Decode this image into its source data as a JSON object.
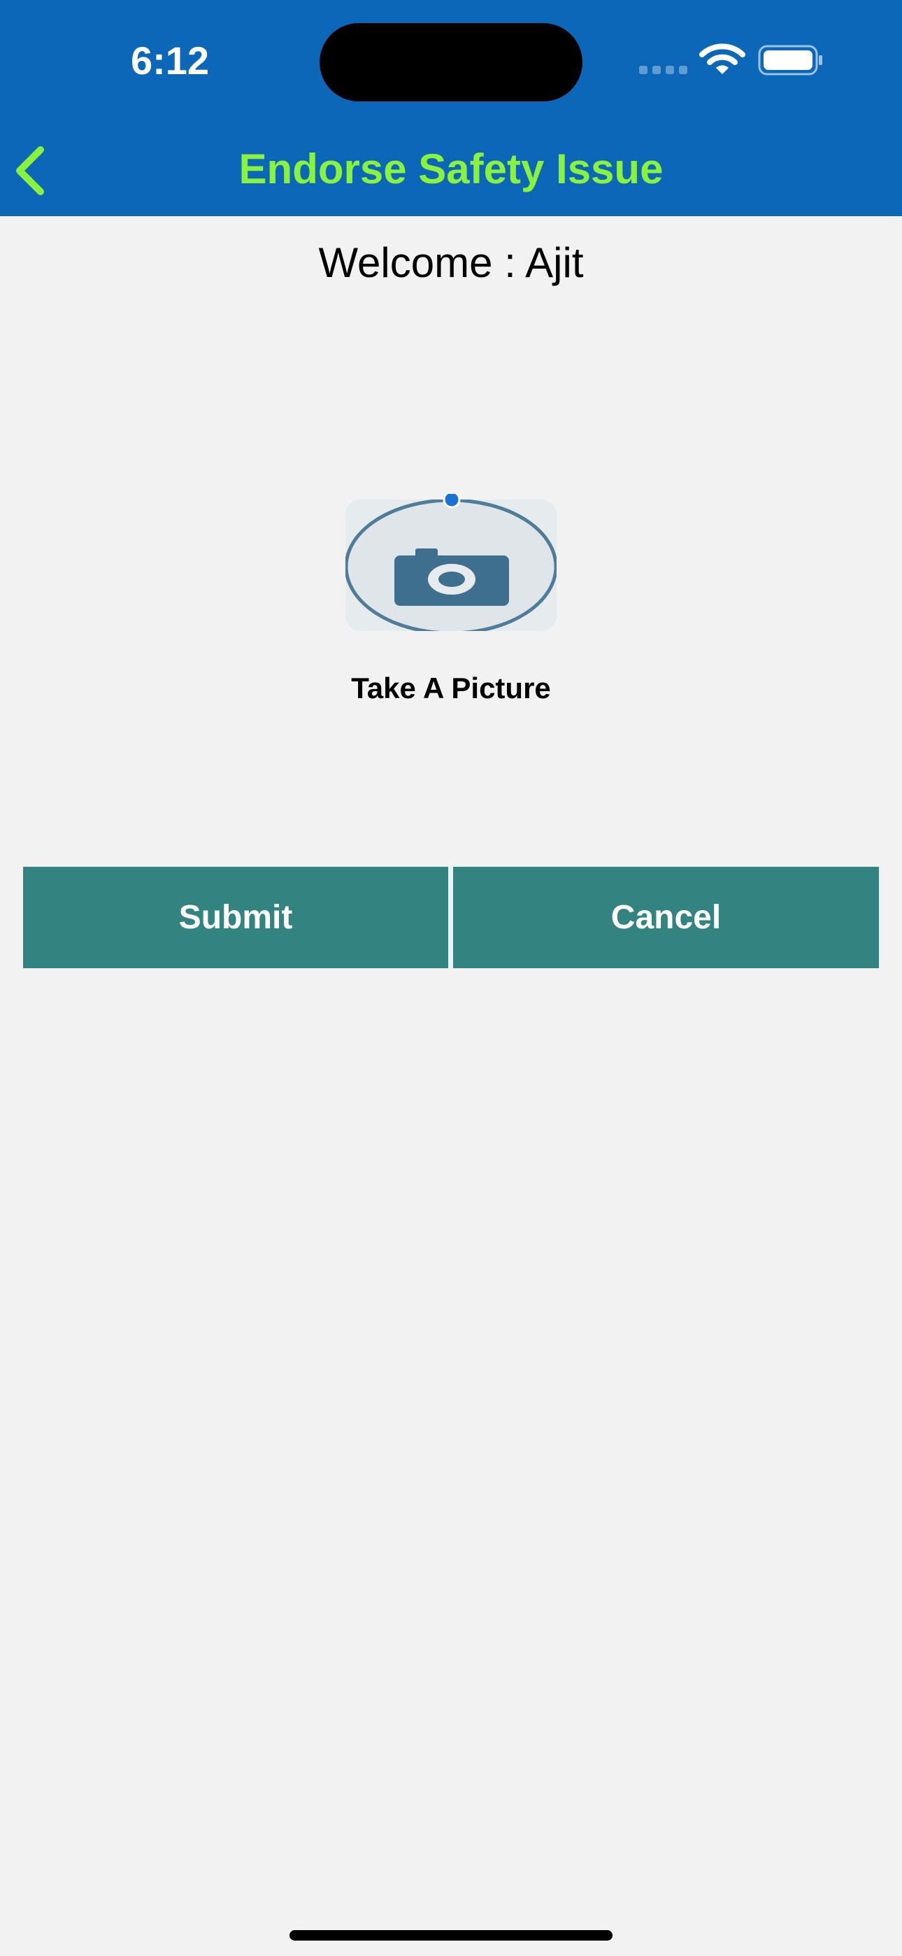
{
  "status_bar": {
    "time": "6:12"
  },
  "nav": {
    "title": "Endorse Safety Issue",
    "back_icon": "chevron-left-icon"
  },
  "main": {
    "welcome": "Welcome : Ajit",
    "camera_icon": "camera-icon",
    "take_picture_label": "Take A Picture"
  },
  "actions": {
    "submit_label": "Submit",
    "cancel_label": "Cancel"
  },
  "colors": {
    "header_bg": "#0c67b9",
    "title_color": "#88f23d",
    "button_bg": "#338380",
    "page_bg": "#f2f2f2"
  }
}
